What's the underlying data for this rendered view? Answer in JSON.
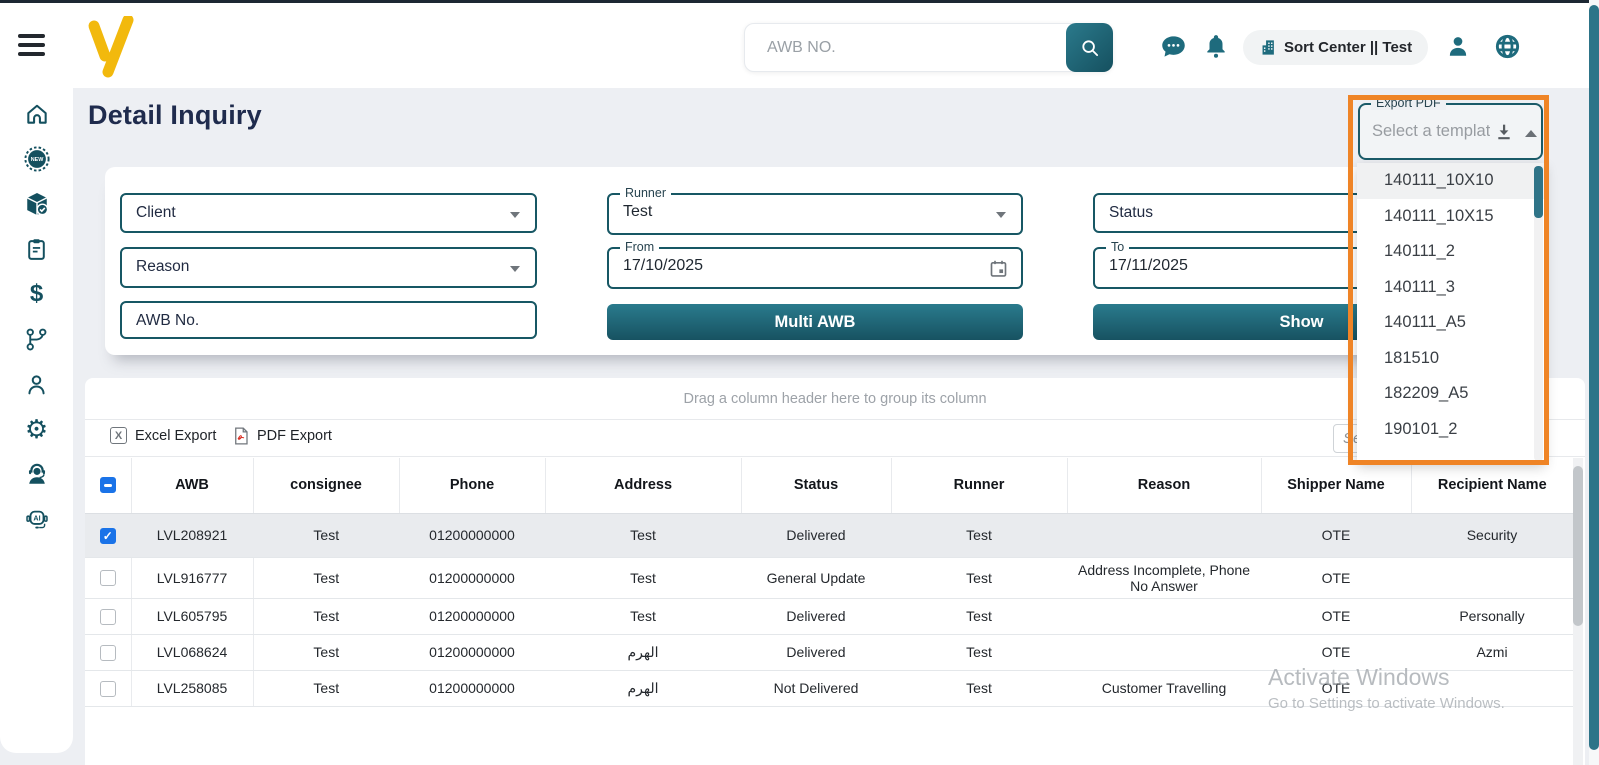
{
  "colors": {
    "accent_teal": "#1e6b7d",
    "dark_teal": "#14505f",
    "title_navy": "#1f2b4d",
    "highlight_orange": "#ef8426",
    "checkbox_blue": "#1a73e8",
    "logo_yellow": "#f2b90d"
  },
  "topbar": {
    "search_placeholder": "AWB NO.",
    "location_badge": "Sort Center || Test"
  },
  "sidebar": {
    "icons": [
      "home-icon",
      "new-badge-icon",
      "package-check-icon",
      "clipboard-icon",
      "dollar-icon",
      "branch-icon",
      "person-icon",
      "settings-gear-icon",
      "support-agent-icon",
      "ai-assistant-icon"
    ]
  },
  "page": {
    "title": "Detail Inquiry"
  },
  "filters": {
    "client": {
      "label": "Client"
    },
    "reason": {
      "label": "Reason"
    },
    "awb": {
      "placeholder": "AWB No."
    },
    "runner": {
      "label": "Runner",
      "value": "Test"
    },
    "from": {
      "label": "From",
      "value": "17/10/2025"
    },
    "to": {
      "label": "To",
      "value": "17/11/2025"
    },
    "status": {
      "label": "Status"
    },
    "multi_awb_button": "Multi AWB",
    "show_button": "Show"
  },
  "export_pdf": {
    "label": "Export PDF",
    "placeholder": "Select a template",
    "active_option": "140111_10X10",
    "options": [
      "140111_10X10",
      "140111_10X15",
      "140111_2",
      "140111_3",
      "140111_A5",
      "181510",
      "182209_A5",
      "190101_2"
    ]
  },
  "table": {
    "group_hint": "Drag a column header here to group its column",
    "excel_export_label": "Excel Export",
    "pdf_export_label": "PDF Export",
    "search_placeholder": "Search",
    "columns": [
      "AWB",
      "consignee",
      "Phone",
      "Address",
      "Status",
      "Runner",
      "Reason",
      "Shipper Name",
      "Recipient Name"
    ],
    "rows": [
      {
        "checked": true,
        "awb": "LVL208921",
        "consignee": "Test",
        "phone": "01200000000",
        "address": "Test",
        "status": "Delivered",
        "runner": "Test",
        "reason": "",
        "shipper_name": "OTE",
        "recipient_name": "Security"
      },
      {
        "checked": false,
        "awb": "LVL916777",
        "consignee": "Test",
        "phone": "01200000000",
        "address": "Test",
        "status": "General Update",
        "runner": "Test",
        "reason": "Address Incomplete, Phone No Answer",
        "shipper_name": "OTE",
        "recipient_name": ""
      },
      {
        "checked": false,
        "awb": "LVL605795",
        "consignee": "Test",
        "phone": "01200000000",
        "address": "Test",
        "status": "Delivered",
        "runner": "Test",
        "reason": "",
        "shipper_name": "OTE",
        "recipient_name": "Personally"
      },
      {
        "checked": false,
        "awb": "LVL068624",
        "consignee": "Test",
        "phone": "01200000000",
        "address": "الهرم",
        "status": "Delivered",
        "runner": "Test",
        "reason": "",
        "shipper_name": "OTE",
        "recipient_name": "Azmi"
      },
      {
        "checked": false,
        "awb": "LVL258085",
        "consignee": "Test",
        "phone": "01200000000",
        "address": "الهرم",
        "status": "Not Delivered",
        "runner": "Test",
        "reason": "Customer Travelling",
        "shipper_name": "OTE",
        "recipient_name": ""
      }
    ]
  },
  "watermark": {
    "line1": "Activate Windows",
    "line2": "Go to Settings to activate Windows."
  }
}
